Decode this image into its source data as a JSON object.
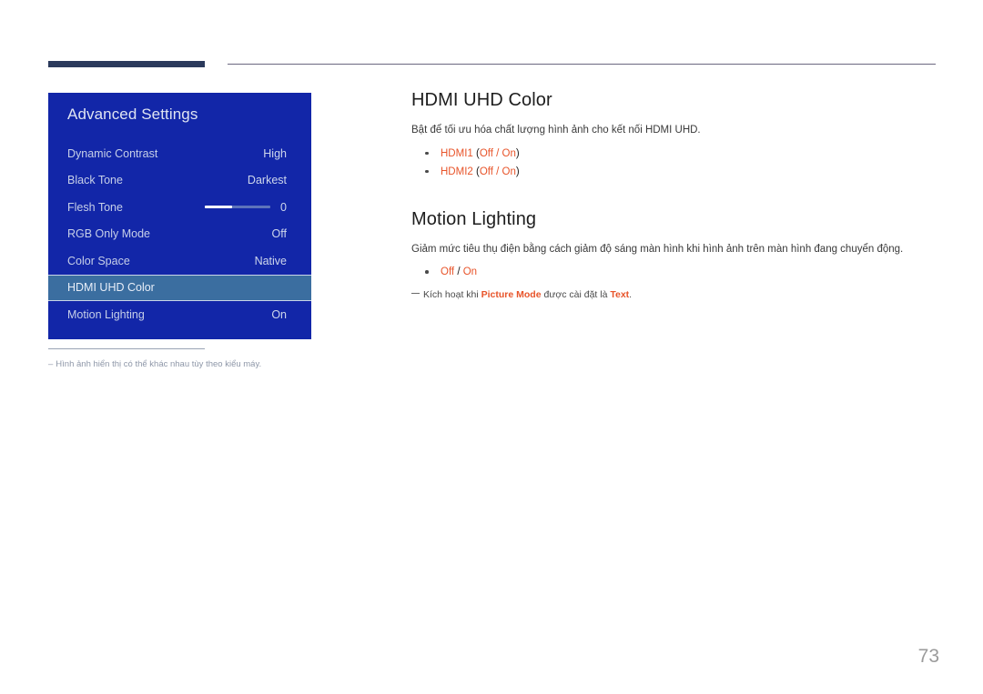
{
  "page": {
    "number": "73"
  },
  "osd": {
    "title": "Advanced Settings",
    "rows": [
      {
        "label": "Dynamic Contrast",
        "value": "High",
        "type": "value",
        "selected": false
      },
      {
        "label": "Black Tone",
        "value": "Darkest",
        "type": "value",
        "selected": false
      },
      {
        "label": "Flesh Tone",
        "value": "0",
        "type": "slider",
        "selected": false,
        "slider_percent": 42
      },
      {
        "label": "RGB Only Mode",
        "value": "Off",
        "type": "value",
        "selected": false
      },
      {
        "label": "Color Space",
        "value": "Native",
        "type": "value",
        "selected": false
      },
      {
        "label": "HDMI UHD Color",
        "value": "",
        "type": "value",
        "selected": true
      },
      {
        "label": "Motion Lighting",
        "value": "On",
        "type": "value",
        "selected": false
      }
    ],
    "colors": {
      "panel_background": "#1226a8",
      "selected_row_background": "#3b6ea0",
      "label_text": "#c6cfe8",
      "title_text": "#dfe4f2"
    }
  },
  "left_footnote": {
    "dash": "–",
    "text": "Hình ảnh hiển thị có thể khác nhau tùy theo kiểu máy."
  },
  "sections": [
    {
      "heading": "HDMI UHD Color",
      "body": "Bật để tối ưu hóa chất lượng hình ảnh cho kết nối HDMI UHD.",
      "options": [
        {
          "name": "HDMI1",
          "open_paren": " (",
          "values": "Off / On",
          "close_paren": ")"
        },
        {
          "name": "HDMI2",
          "open_paren": " (",
          "values": "Off / On",
          "close_paren": ")"
        }
      ]
    },
    {
      "heading": "Motion Lighting",
      "body": "Giảm mức tiêu thụ điện bằng cách giảm độ sáng màn hình khi hình ảnh trên màn hình đang chuyển động.",
      "simple_option": {
        "off": "Off",
        "sep": " / ",
        "on": "On"
      },
      "note": {
        "before": "Kích hoạt khi ",
        "bold1": "Picture Mode",
        "middle": " được cài đặt là ",
        "bold2": "Text",
        "after": "."
      }
    }
  ],
  "theme": {
    "accent": "#e8542a",
    "header_bar": "#2b3a5c",
    "header_rule": "#6b6880",
    "page_number_color": "#9b9b9b"
  }
}
